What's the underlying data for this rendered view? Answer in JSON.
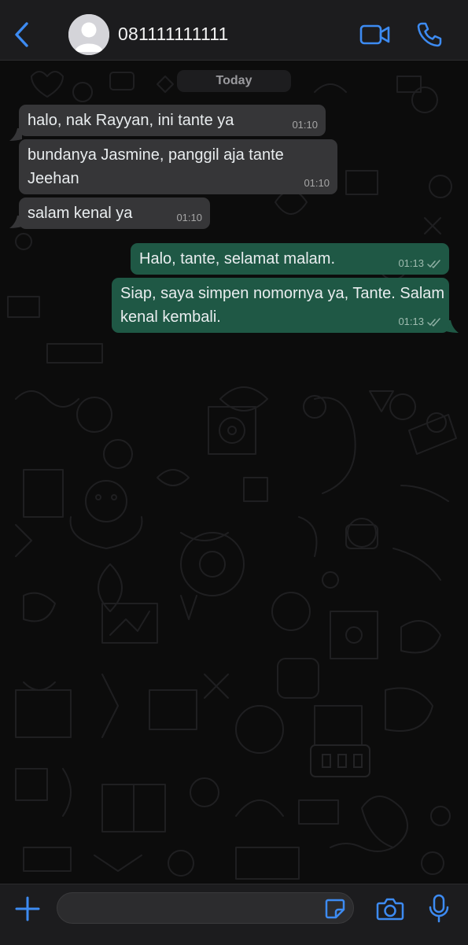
{
  "header": {
    "back_icon": "chevron-left-icon",
    "contact_name": "081111111111",
    "avatar_icon": "default-person-avatar",
    "video_call_icon": "video-camera-icon",
    "voice_call_icon": "phone-icon"
  },
  "chat": {
    "date_separator": "Today",
    "messages": [
      {
        "direction": "incoming",
        "text": "halo, nak Rayyan, ini tante ya",
        "time": "01:10"
      },
      {
        "direction": "incoming",
        "text": "bundanya Jasmine, panggil aja tante Jeehan",
        "time": "01:10"
      },
      {
        "direction": "incoming",
        "text": "salam kenal ya",
        "time": "01:10"
      },
      {
        "direction": "outgoing",
        "text": "Halo, tante, selamat malam.",
        "time": "01:13",
        "status": "read-double-check"
      },
      {
        "direction": "outgoing",
        "text": "Siap, saya simpen nomornya ya, Tante. Salam kenal kembali.",
        "time": "01:13",
        "status": "read-double-check"
      }
    ]
  },
  "input_bar": {
    "attach_icon": "plus-icon",
    "message_value": "",
    "sticker_icon": "sticker-icon",
    "camera_icon": "camera-icon",
    "mic_icon": "microphone-icon"
  },
  "colors": {
    "accent": "#3d8bf2",
    "header_bg": "#1c1c1e",
    "incoming_bubble": "#363638",
    "outgoing_bubble": "#1f5845",
    "chat_bg": "#0c0c0c"
  }
}
